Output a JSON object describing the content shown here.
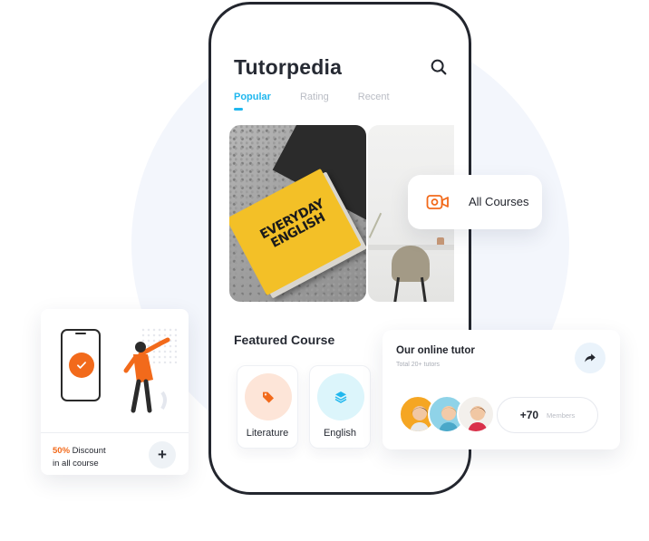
{
  "app": {
    "title": "Tutorpedia"
  },
  "tabs": [
    {
      "label": "Popular",
      "active": true
    },
    {
      "label": "Rating",
      "active": false
    },
    {
      "label": "Recent",
      "active": false
    }
  ],
  "gallery": {
    "book_cover_text": "EVERYDAY ENGLISH"
  },
  "featured": {
    "title": "Featured Course",
    "categories": [
      {
        "label": "Literature",
        "icon": "tag-icon",
        "color": "#f26a1b"
      },
      {
        "label": "English",
        "icon": "layers-icon",
        "color": "#20b7ee"
      }
    ]
  },
  "all_courses": {
    "label": "All Courses",
    "icon": "video-camera-icon"
  },
  "discount": {
    "percent": "50%",
    "text": " Discount",
    "line2": "in all course",
    "action": "+"
  },
  "tutors": {
    "title": "Our online tutor",
    "subtitle": "Total 20+ tutors",
    "members_count": "+70",
    "members_label": "Members"
  },
  "colors": {
    "accent_blue": "#20b7ee",
    "accent_orange": "#f26a1b",
    "dark": "#23262e"
  }
}
